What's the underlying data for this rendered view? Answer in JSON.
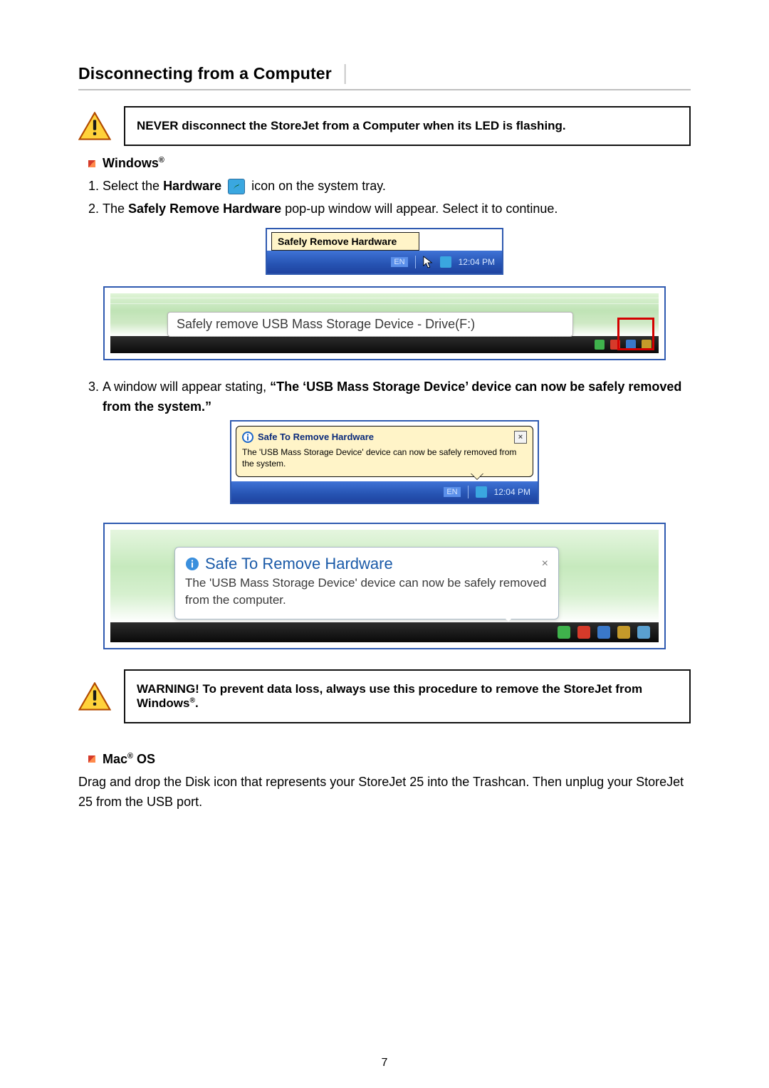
{
  "section": {
    "title": "Disconnecting from a Computer",
    "pipe": "│"
  },
  "callout_top": {
    "text": "NEVER disconnect the StoreJet from a Computer when its LED is flashing."
  },
  "subhead_windows": "Windows",
  "steps": {
    "s1_a": "Select the ",
    "s1_b_bold": "Hardware",
    "s1_c": " icon on the system tray.",
    "s2_a": "The ",
    "s2_b_bold": "Safely Remove Hardware",
    "s2_c": " pop-up window will appear. Select it to continue.",
    "s3_a": "A window will appear stating, ",
    "s3_b_bold": "“The ‘USB Mass Storage Device’ device can now be safely removed from the system",
    "s3_c": ".”"
  },
  "xp_tooltip": {
    "label": "Safely Remove Hardware",
    "lang": "EN",
    "time": "12:04 PM"
  },
  "vista_row": {
    "popup_text": "Safely remove USB Mass Storage Device - Drive(F:)"
  },
  "xp_balloon": {
    "title": "Safe To Remove Hardware",
    "body": "The 'USB Mass Storage Device' device can now be safely removed from the system.",
    "lang": "EN",
    "time": "12:04 PM"
  },
  "vista_balloon": {
    "title": "Safe To Remove Hardware",
    "body": "The 'USB Mass Storage Device' device can now be safely removed from the computer."
  },
  "callout_warning": {
    "text_a": "WARNING! To prevent data loss, always use this procedure to remove the StoreJet from Windows",
    "text_b": "."
  },
  "subhead_mac": "Mac",
  "subhead_mac_os": " OS",
  "mac_paragraph": "Drag and drop the Disk icon that represents your StoreJet 25 into the Trashcan. Then unplug your StoreJet 25 from the USB port.",
  "page_number": "7"
}
